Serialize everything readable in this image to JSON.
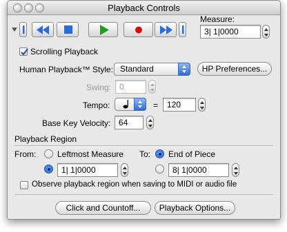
{
  "window": {
    "title": "Playback Controls"
  },
  "transport": {
    "buttons": [
      "rewind",
      "stop",
      "play",
      "record",
      "fast-forward"
    ],
    "measure_label": "Measure:",
    "measure_value": "3| 1|0000"
  },
  "scrolling": {
    "label": "Scrolling Playback",
    "checked": true
  },
  "human_playback": {
    "label": "Human Playback™ Style:",
    "value": "Standard",
    "prefs_button": "HP Preferences..."
  },
  "swing": {
    "label": "Swing:",
    "value": "0"
  },
  "tempo": {
    "label": "Tempo:",
    "equals": "=",
    "value": "120",
    "note_icon": "quarter-note"
  },
  "velocity": {
    "label": "Base Key Velocity:",
    "value": "64"
  },
  "region": {
    "header": "Playback Region",
    "from_label": "From:",
    "from_leftmost": "Leftmost Measure",
    "from_value": "1| 1|0000",
    "to_label": "To:",
    "to_end": "End of Piece",
    "to_value": "8| 1|0000",
    "selected_from": "value",
    "selected_to": "end"
  },
  "observe": {
    "label": "Observe playback region when saving to MIDI or audio file",
    "checked": false
  },
  "bottom_buttons": {
    "click_countoff": "Click and Countoff...",
    "playback_options": "Playback Options..."
  },
  "colors": {
    "accent": "#2e6fd6",
    "play": "#1aa31a",
    "record": "#d01010"
  }
}
